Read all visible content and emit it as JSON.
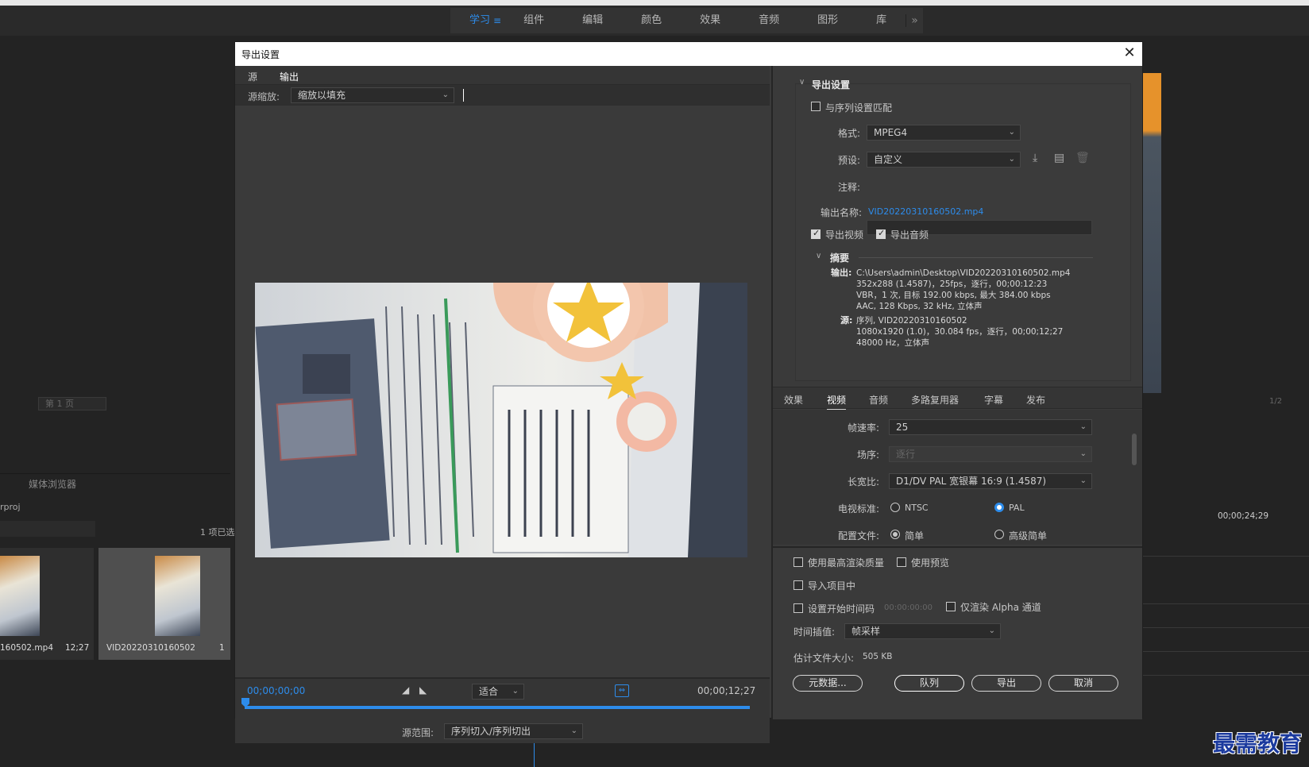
{
  "workspace": {
    "tabs": [
      "学习",
      "组件",
      "编辑",
      "颜色",
      "效果",
      "音频",
      "图形",
      "库"
    ],
    "more_icon": "»"
  },
  "background": {
    "page_select": "第 1 页",
    "media_browser_tab": "媒体浏览器",
    "project_file": "rproj",
    "item_count": "1 项已选",
    "clip1_name": "160502.mp4",
    "clip1_duration": "12;27",
    "clip2_name": "VID20220310160502",
    "clip2_duration": "1",
    "timeline_timecode": "00;00;24;29",
    "page_right": "1/2",
    "watermark": "最需教育"
  },
  "dialog": {
    "title": "导出设置",
    "close_icon": "✕"
  },
  "preview": {
    "tab_source": "源",
    "tab_output": "输出",
    "scale_label": "源缩放:",
    "scale_value": "缩放以填充",
    "timecode_start": "00;00;00;00",
    "timecode_end": "00;00;12;27",
    "fit_value": "适合",
    "range_label": "源范围:",
    "range_value": "序列切入/序列切出",
    "playhead_fraction": 0
  },
  "export_settings": {
    "section_title": "导出设置",
    "match_sequence_label": "与序列设置匹配",
    "match_sequence_checked": false,
    "format_label": "格式:",
    "format_value": "MPEG4",
    "preset_label": "预设:",
    "preset_value": "自定义",
    "comment_label": "注释:",
    "comment_value": "",
    "output_name_label": "输出名称:",
    "output_name_value": "VID20220310160502.mp4",
    "export_video_label": "导出视频",
    "export_video_checked": true,
    "export_audio_label": "导出音频",
    "export_audio_checked": true,
    "summary_title": "摘要",
    "summary_output_key": "输出:",
    "summary_output_lines": [
      "C:\\Users\\admin\\Desktop\\VID20220310160502.mp4",
      "352x288 (1.4587)，25fps，逐行，00;00:12:23",
      "VBR，1 次, 目标 192.00 kbps, 最大 384.00 kbps",
      "AAC, 128 Kbps, 32 kHz, 立体声"
    ],
    "summary_source_key": "源:",
    "summary_source_lines": [
      "序列, VID20220310160502",
      "1080x1920 (1.0)，30.084 fps，逐行，00;00;12;27",
      "48000 Hz，立体声"
    ]
  },
  "settings_tabs": [
    "效果",
    "视频",
    "音频",
    "多路复用器",
    "字幕",
    "发布"
  ],
  "video": {
    "framerate_label": "帧速率:",
    "framerate_value": "25",
    "field_order_label": "场序:",
    "field_order_value": "逐行",
    "aspect_label": "长宽比:",
    "aspect_value": "D1/DV PAL 宽银幕 16:9 (1.4587)",
    "tv_standard_label": "电视标准:",
    "tv_ntsc": "NTSC",
    "tv_pal": "PAL",
    "profile_label": "配置文件:",
    "profile_simple": "简单",
    "profile_advanced": "高级简单"
  },
  "bottom": {
    "max_render_label": "使用最高渲染质量",
    "use_previews_label": "使用预览",
    "import_project_label": "导入项目中",
    "set_start_tc_label": "设置开始时间码",
    "start_tc_value": "00:00:00:00",
    "alpha_only_label": "仅渲染 Alpha 通道",
    "time_interp_label": "时间插值:",
    "time_interp_value": "帧采样",
    "est_size_label": "估计文件大小:",
    "est_size_value": "505 KB",
    "metadata_btn": "元数据...",
    "queue_btn": "队列",
    "export_btn": "导出",
    "cancel_btn": "取消"
  },
  "colors": {
    "accent": "#2d8ceb",
    "dialog_bg": "#3a3a3a",
    "app_bg": "#232323"
  }
}
